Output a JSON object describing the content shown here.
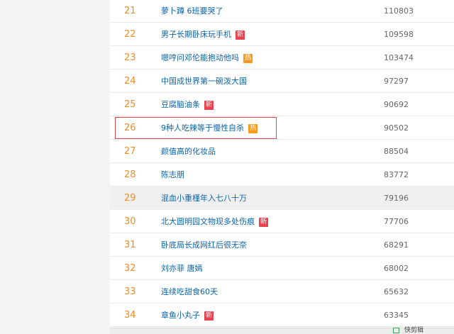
{
  "list": {
    "rows": [
      {
        "rank": "21",
        "title": "萝卜蹲 6班要哭了",
        "badge": "",
        "count": "110803"
      },
      {
        "rank": "22",
        "title": "男子长期卧床玩手机",
        "badge": "新",
        "count": "109598"
      },
      {
        "rank": "23",
        "title": "嗯哼问邓伦能抱动他吗",
        "badge": "热",
        "count": "103474"
      },
      {
        "rank": "24",
        "title": "中国成世界第一碗泼大国",
        "badge": "",
        "count": "97297"
      },
      {
        "rank": "25",
        "title": "豆腐脑油条",
        "badge": "新",
        "count": "90692"
      },
      {
        "rank": "26",
        "title": "9种人吃辣等于慢性自杀",
        "badge": "热",
        "count": "90502"
      },
      {
        "rank": "27",
        "title": "颜值高的化妆品",
        "badge": "",
        "count": "88504"
      },
      {
        "rank": "28",
        "title": "陈志朋",
        "badge": "",
        "count": "83772"
      },
      {
        "rank": "29",
        "title": "混血小重槿年入七八十万",
        "badge": "",
        "count": "79196"
      },
      {
        "rank": "30",
        "title": "北大圆明园文物现多处伤痕",
        "badge": "新",
        "count": "77706"
      },
      {
        "rank": "31",
        "title": "卧底局长成网红后很无奈",
        "badge": "",
        "count": "68291"
      },
      {
        "rank": "32",
        "title": "刘亦菲 唐嫣",
        "badge": "",
        "count": "68002"
      },
      {
        "rank": "33",
        "title": "连续吃甜食60天",
        "badge": "",
        "count": "65632"
      },
      {
        "rank": "34",
        "title": "章鱼小丸子",
        "badge": "新",
        "count": "63345"
      }
    ]
  },
  "footer": {
    "text": "快剪辑"
  },
  "colors": {
    "rank": "#f08a24",
    "title": "#0a63a8",
    "badge_new": "#e8434f",
    "badge_hot": "#f79a1d",
    "highlight_border": "#e2434b"
  }
}
